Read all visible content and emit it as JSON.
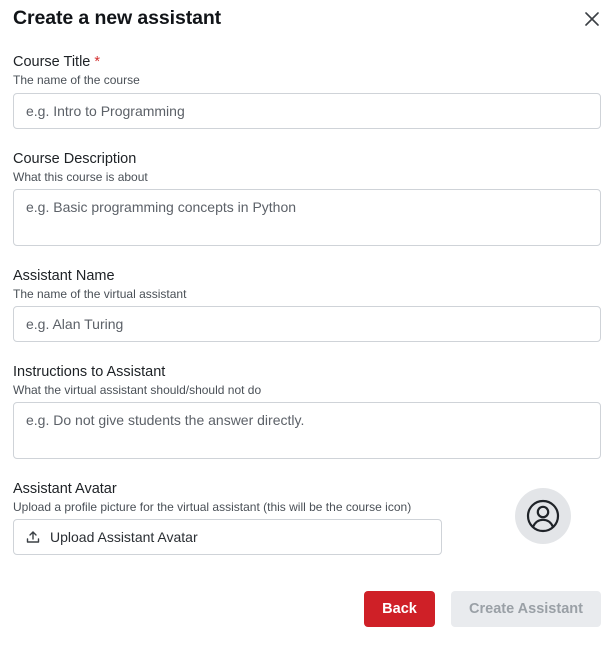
{
  "dialog": {
    "title": "Create a new assistant"
  },
  "fields": {
    "course_title": {
      "label": "Course Title",
      "required_mark": "*",
      "description": "The name of the course",
      "placeholder": "e.g. Intro to Programming",
      "value": ""
    },
    "course_description": {
      "label": "Course Description",
      "description": "What this course is about",
      "placeholder": "e.g. Basic programming concepts in Python",
      "value": ""
    },
    "assistant_name": {
      "label": "Assistant Name",
      "description": "The name of the virtual assistant",
      "placeholder": "e.g. Alan Turing",
      "value": ""
    },
    "instructions": {
      "label": "Instructions to Assistant",
      "description": "What the virtual assistant should/should not do",
      "placeholder": "e.g. Do not give students the answer directly.",
      "value": ""
    },
    "avatar": {
      "label": "Assistant Avatar",
      "description": "Upload a profile picture for the virtual assistant (this will be the course icon)",
      "upload_label": "Upload Assistant Avatar",
      "upload_icon": "upload-icon",
      "preview_icon": "user-circle-icon"
    }
  },
  "actions": {
    "back_label": "Back",
    "create_label": "Create Assistant",
    "create_disabled": true
  },
  "colors": {
    "back_button": "#cf2027",
    "create_button_disabled_bg": "#e9ebee",
    "create_button_disabled_text": "#9aa0a6",
    "required_mark": "#d32f2f",
    "avatar_bg": "#e3e5e8"
  }
}
